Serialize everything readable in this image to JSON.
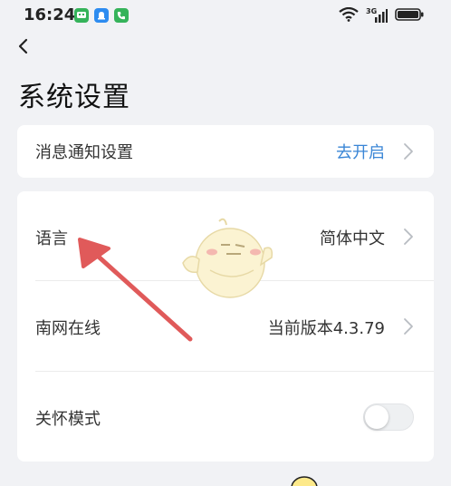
{
  "status_bar": {
    "time": "16:24",
    "network_label": "3G",
    "icons": [
      "message-app-icon",
      "notification-bell-icon",
      "phone-app-icon",
      "wifi-icon",
      "signal-icon",
      "battery-icon"
    ]
  },
  "header": {
    "back_icon": "chevron-left-icon",
    "title": "系统设置"
  },
  "notification_card": {
    "label": "消息通知设置",
    "action": "去开启"
  },
  "settings_card": {
    "language": {
      "label": "语言",
      "value": "简体中文"
    },
    "online": {
      "label": "南网在线",
      "value": "当前版本4.3.79"
    },
    "care_mode": {
      "label": "关怀模式",
      "enabled": false
    }
  },
  "colors": {
    "background": "#f1f2f5",
    "card": "#ffffff",
    "link": "#3a86d6",
    "annotation_arrow": "#e05a5a"
  }
}
